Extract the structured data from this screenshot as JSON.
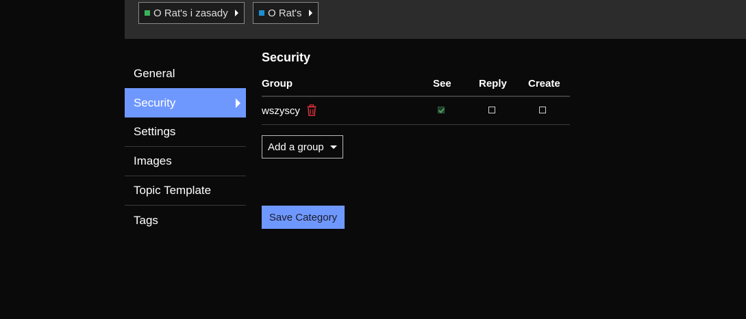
{
  "breadcrumbs": [
    {
      "label": "O Rat's i zasady",
      "color": "#3bb25a"
    },
    {
      "label": "O Rat's",
      "color": "#1d8fd1"
    }
  ],
  "sidebar": {
    "items": [
      {
        "label": "General",
        "active": false
      },
      {
        "label": "Security",
        "active": true
      },
      {
        "label": "Settings",
        "active": false
      },
      {
        "label": "Images",
        "active": false
      },
      {
        "label": "Topic Template",
        "active": false
      },
      {
        "label": "Tags",
        "active": false
      }
    ]
  },
  "security": {
    "title": "Security",
    "columns": {
      "group": "Group",
      "see": "See",
      "reply": "Reply",
      "create": "Create"
    },
    "rows": [
      {
        "group": "wszyscy",
        "see": true,
        "reply": false,
        "create": false
      }
    ],
    "add_group_label": "Add a group"
  },
  "actions": {
    "save_label": "Save Category"
  },
  "colors": {
    "accent": "#6f98ff",
    "delete": "#e0303a"
  },
  "icons": {
    "delete": "trash-icon",
    "nav_active": "caret-right-icon",
    "dropdown": "caret-down-icon"
  }
}
